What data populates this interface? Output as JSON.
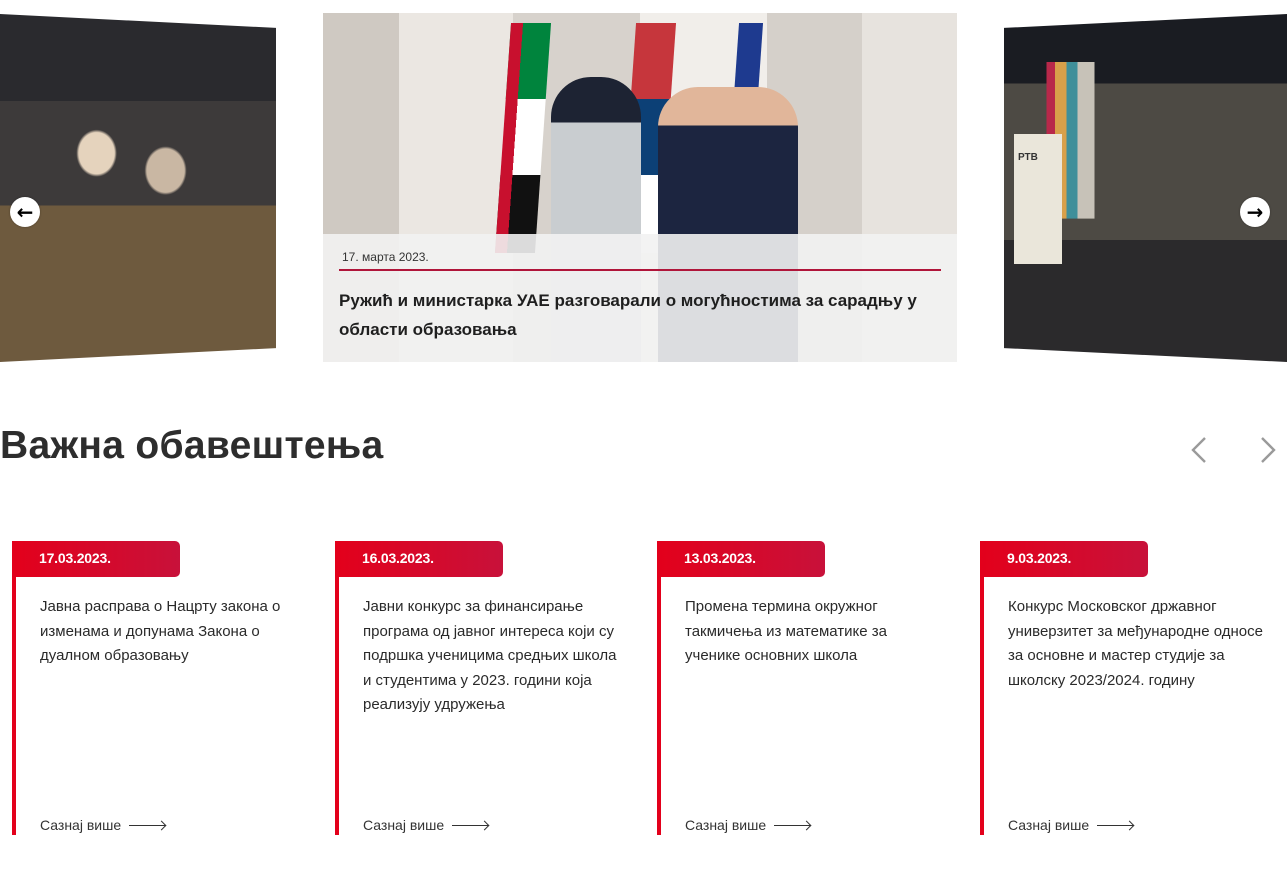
{
  "carousel": {
    "prev_icon": "arrow-left-icon",
    "next_icon": "arrow-right-icon",
    "prev_glyph": "←",
    "next_glyph": "→",
    "main_slide": {
      "date": "17. марта 2023.",
      "title": "Ружић и министарка УАЕ разговарали о могућностима за сарадњу у области образовања"
    },
    "side_right_poster": "РТВ"
  },
  "notices": {
    "title": "Важна обавештења",
    "prev_icon": "chevron-left-icon",
    "next_icon": "chevron-right-icon",
    "accent_color": "#e3001b",
    "items": [
      {
        "date": "17.03.2023.",
        "text": "Јавна расправа о Нацрту закона о изменама и допунама Закона о дуалном образовању",
        "more": "Сазнај више"
      },
      {
        "date": "16.03.2023.",
        "text": "Јавни конкурс за финансирање програма од јавног интереса који су подршка ученицима средњих школа и студентима у 2023. години која реализују удружења",
        "more": "Сазнај више"
      },
      {
        "date": "13.03.2023.",
        "text": "Промена термина окружног такмичења из математике за ученике основних школа",
        "more": "Сазнај више"
      },
      {
        "date": "9.03.2023.",
        "text": "Конкурс Московског државног универзитет за међународне односе за основне и мастер студије за школску 2023/2024. годину",
        "more": "Сазнај више"
      }
    ]
  }
}
